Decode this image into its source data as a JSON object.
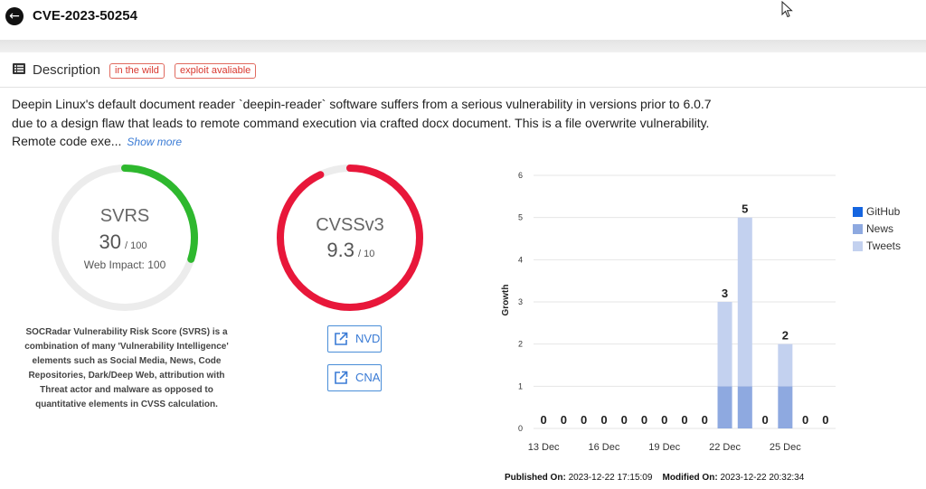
{
  "header": {
    "title": "CVE-2023-50254"
  },
  "description": {
    "heading": "Description",
    "badges": [
      "in the wild",
      "exploit avaliable"
    ],
    "text": "Deepin Linux's default document reader `deepin-reader` software suffers from a serious vulnerability in versions prior to 6.0.7 due to a design flaw that leads to remote command execution via crafted docx document. This is a file overwrite vulnerability. Remote code exe...",
    "show_more": "Show more"
  },
  "svrs": {
    "label": "SVRS",
    "score": "30",
    "max": "/ 100",
    "web_impact": "Web Impact: 100",
    "fraction": 0.3,
    "color": "#2eb82e",
    "explanation": "SOCRadar Vulnerability Risk Score (SVRS) is a combination of many 'Vulnerability Intelligence' elements such as Social Media, News, Code Repositories, Dark/Deep Web, attribution with Threat actor and malware as opposed to quantitative elements in CVSS calculation."
  },
  "cvss": {
    "label": "CVSSv3",
    "score": "9.3",
    "max": "/ 10",
    "fraction": 0.93,
    "color": "#e8173a"
  },
  "links": {
    "nvd": "NVD",
    "cna": "CNA"
  },
  "chart_data": {
    "type": "bar",
    "stacked": true,
    "categories": [
      "13 Dec",
      "14 Dec",
      "15 Dec",
      "16 Dec",
      "17 Dec",
      "18 Dec",
      "19 Dec",
      "20 Dec",
      "21 Dec",
      "22 Dec",
      "23 Dec",
      "24 Dec",
      "25 Dec",
      "26 Dec",
      "27 Dec"
    ],
    "tick_labels": [
      "13 Dec",
      "16 Dec",
      "19 Dec",
      "22 Dec",
      "25 Dec"
    ],
    "series": [
      {
        "name": "GitHub",
        "color": "#1565e0",
        "values": [
          0,
          0,
          0,
          0,
          0,
          0,
          0,
          0,
          0,
          0,
          0,
          0,
          0,
          0,
          0
        ]
      },
      {
        "name": "News",
        "color": "#8ea9e0",
        "values": [
          0,
          0,
          0,
          0,
          0,
          0,
          0,
          0,
          0,
          1,
          1,
          0,
          1,
          0,
          0
        ]
      },
      {
        "name": "Tweets",
        "color": "#c3d1ef",
        "values": [
          0,
          0,
          0,
          0,
          0,
          0,
          0,
          0,
          0,
          2,
          4,
          0,
          1,
          0,
          0
        ]
      }
    ],
    "totals": [
      0,
      0,
      0,
      0,
      0,
      0,
      0,
      0,
      0,
      3,
      5,
      0,
      2,
      0,
      0
    ],
    "ylabel": "Growth",
    "ylim": [
      0,
      6
    ],
    "yticks": [
      0,
      1,
      2,
      3,
      4,
      5,
      6
    ],
    "grid": true,
    "legend": "right"
  },
  "footer": {
    "published_label": "Published On:",
    "published_value": "2023-12-22 17:15:09",
    "modified_label": "Modified On:",
    "modified_value": "2023-12-22 20:32:34"
  }
}
